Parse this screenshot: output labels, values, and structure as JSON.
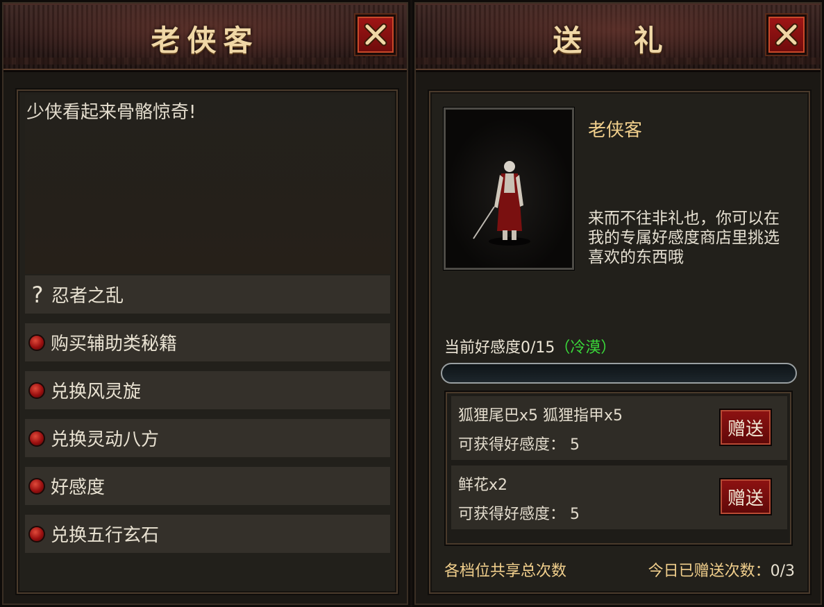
{
  "left_panel": {
    "title": "老侠客",
    "close_label": "X",
    "greeting": "少侠看起来骨骼惊奇!",
    "menu": [
      {
        "icon": "question-icon",
        "glyph": "?",
        "label": "忍者之乱"
      },
      {
        "icon": "red-dot-icon",
        "label": "购买辅助类秘籍"
      },
      {
        "icon": "red-dot-icon",
        "label": "兑换风灵旋"
      },
      {
        "icon": "red-dot-icon",
        "label": "兑换灵动八方"
      },
      {
        "icon": "red-dot-icon",
        "label": "好感度"
      },
      {
        "icon": "red-dot-icon",
        "label": "兑换五行玄石"
      }
    ]
  },
  "right_panel": {
    "title": "送 礼",
    "close_label": "X",
    "npc": {
      "name": "老侠客",
      "description": "来而不往非礼也，你可以在我的专属好感度商店里挑选喜欢的东西哦"
    },
    "affinity": {
      "label": "当前好感度0/15",
      "status": "（冷漠）",
      "current": 0,
      "max": 15
    },
    "gifts": [
      {
        "items": "狐狸尾巴x5 狐狸指甲x5",
        "points_text": "可获得好感度： 5",
        "button": "赠送"
      },
      {
        "items": "鲜花x2",
        "points_text": "可获得好感度： 5",
        "button": "赠送"
      }
    ],
    "footer": {
      "shared_note": "各档位共享总次数",
      "daily_label": "今日已赠送次数：",
      "daily_count": "0/3"
    }
  },
  "colors": {
    "accent_gold": "#f1cf8c",
    "status_green": "#3ad83a",
    "button_red": "#8e1212"
  }
}
